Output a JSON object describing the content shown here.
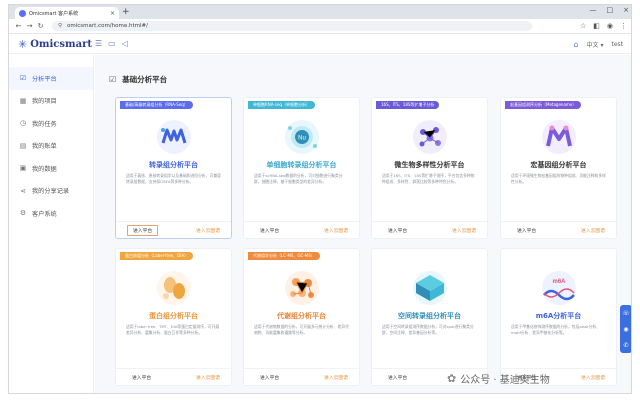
{
  "browser": {
    "tab_title": "Omicsmart 客户系统",
    "tab_close": "×",
    "new_tab": "+",
    "url": "omicsmart.com/home.html#/",
    "window_controls": [
      "—",
      "□",
      "×"
    ]
  },
  "app": {
    "logo_mark": "✳",
    "logo_text": "Omicsmart",
    "lang_label": "中文",
    "user_label": "test"
  },
  "sidebar": {
    "items": [
      {
        "label": "分析平台",
        "icon": "platform-icon",
        "glyph": "☑",
        "active": true
      },
      {
        "label": "我的项目",
        "icon": "grid-icon",
        "glyph": "▦",
        "active": false
      },
      {
        "label": "我的任务",
        "icon": "task-icon",
        "glyph": "◷",
        "active": false
      },
      {
        "label": "我的账单",
        "icon": "bill-icon",
        "glyph": "▤",
        "active": false
      },
      {
        "label": "我的数据",
        "icon": "data-icon",
        "glyph": "▣",
        "active": false
      },
      {
        "label": "我的分享记录",
        "icon": "share-icon",
        "glyph": "⋖",
        "active": false
      },
      {
        "label": "客户系统",
        "icon": "customer-icon",
        "glyph": "⚙",
        "active": false
      }
    ]
  },
  "main": {
    "heading": "基础分析平台",
    "cards": [
      {
        "badge": "基础/高级转录组分析（RNA-Seq）",
        "badge_color": "#5b6de8",
        "title": "转录组分析平台",
        "title_color": "#3e63dd",
        "icon": "transcriptome-logo-icon",
        "desc": "适用于真核、原核转录组学以及基础和进阶分析，可兼容转录组数据，支持如GSEA等多种分析。",
        "enter": "进入平台",
        "cloud": "进入云图谱",
        "selected": true
      },
      {
        "badge": "单细胞RNA-seq（单细胞分析）",
        "badge_color": "#3fb8d8",
        "title": "单细胞转录组分析平台",
        "title_color": "#3aa9c9",
        "icon": "single-cell-logo-icon",
        "desc": "适用于scRNA-seq数据的分析，可对细胞进行聚类分群，细胞注释，基于细胞类型的差异分析。",
        "enter": "进入平台",
        "cloud": "进入云图谱",
        "selected": false
      },
      {
        "badge": "16S、ITS、18S等扩增子分析",
        "badge_color": "#6b5ad6",
        "title": "微生物多样性分析平台",
        "title_color": "#333333",
        "icon": "microbe-logo-icon",
        "desc": "适用于16S、ITS、18S等扩增子测序，平台包含多种物种组成、多样性、群落比较等多种特色分析。",
        "enter": "进入平台",
        "cloud": "进入云图谱",
        "selected": false
      },
      {
        "badge": "宏基因组测序分析（Metagenome）",
        "badge_color": "#7b5bd8",
        "title": "宏基因组分析平台",
        "title_color": "#333333",
        "icon": "metagenome-logo-icon",
        "desc": "适用于环境微生物宏基因组的物种组成、功能注释和多样性分析。",
        "enter": "进入平台",
        "cloud": "进入云图谱",
        "selected": false
      },
      {
        "badge": "蛋白质组分析（Label-free、DIA）",
        "badge_color": "#f0a640",
        "title": "蛋白组分析平台",
        "title_color": "#e89438",
        "icon": "protein-logo-icon",
        "desc": "适用于label free、TMT、DIA等蛋白定量测序，可开展差异分析、富集分析、蛋白互作等多种分析。",
        "enter": "进入平台",
        "cloud": "进入云图谱",
        "selected": false
      },
      {
        "badge": "代谢组学分析（LC-MS、GC-MS）",
        "badge_color": "#f08a3c",
        "title": "代谢组分析平台",
        "title_color": "#e8853a",
        "icon": "metabolome-logo-icon",
        "desc": "适用于代谢物数据的分析，可开展多元统计分析、差异代谢物、功能富集和通路等分析。",
        "enter": "进入平台",
        "cloud": "进入云图谱",
        "selected": false
      },
      {
        "badge": "",
        "badge_color": "",
        "title": "空间转录组分析平台",
        "title_color": "#2f8fb8",
        "icon": "spatial-logo-icon",
        "desc": "适用于空间转录组测序数据分析，可对spot进行聚类分群、空间注释、差异基因分析等。",
        "enter": "进入平台",
        "cloud": "",
        "selected": false
      },
      {
        "badge": "",
        "badge_color": "",
        "title": "m6A分析平台",
        "title_color": "#3e63dd",
        "icon": "m6a-logo-icon",
        "desc": "适用于甲基化修饰测序数据的分析，包括peak分析、motif分析、差异甲基化分析等。",
        "enter": "进入平台",
        "cloud": "进入云图谱",
        "selected": false
      }
    ]
  },
  "float_bar": [
    "☏",
    "◉",
    "✆"
  ],
  "watermark": "公众号 · 基迪奥生物"
}
